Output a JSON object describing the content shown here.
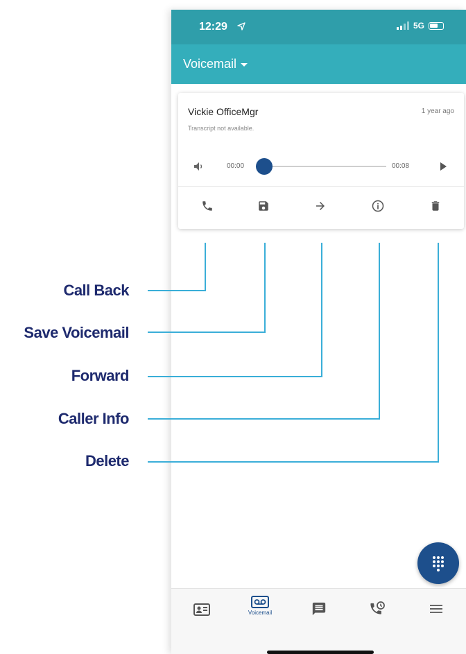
{
  "status_bar": {
    "time": "12:29",
    "network": "5G"
  },
  "app_bar": {
    "title": "Voicemail"
  },
  "voicemail": {
    "caller": "Vickie OfficeMgr",
    "age": "1 year ago",
    "transcript": "Transcript not available.",
    "elapsed": "00:00",
    "duration": "00:08",
    "progress": 0
  },
  "actions": [
    {
      "icon": "phone-icon",
      "callout": "Call Back"
    },
    {
      "icon": "save-icon",
      "callout": "Save Voicemail"
    },
    {
      "icon": "forward-arrow-icon",
      "callout": "Forward"
    },
    {
      "icon": "info-icon",
      "callout": "Caller Info"
    },
    {
      "icon": "trash-icon",
      "callout": "Delete"
    }
  ],
  "bottom_nav": {
    "items": [
      {
        "icon": "contacts-icon",
        "label": ""
      },
      {
        "icon": "voicemail-icon",
        "label": "Voicemail",
        "active": true
      },
      {
        "icon": "chat-icon",
        "label": ""
      },
      {
        "icon": "call-history-icon",
        "label": ""
      },
      {
        "icon": "menu-icon",
        "label": ""
      }
    ]
  },
  "colors": {
    "status_bar": "#2f9eaa",
    "app_bar": "#34aebb",
    "accent": "#1d4f8c",
    "callout_text": "#1e2a6e",
    "callout_line": "#3aaed8"
  }
}
